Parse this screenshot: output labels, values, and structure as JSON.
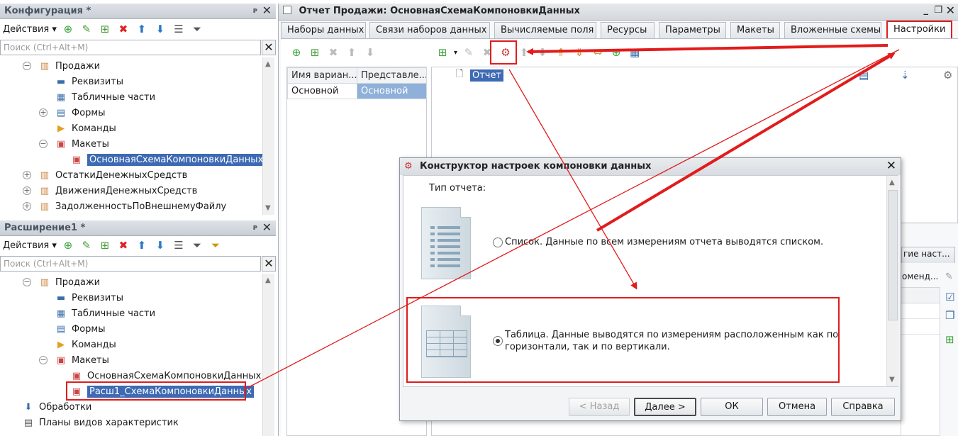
{
  "config_panel": {
    "title": "Конфигурация *",
    "actions_label": "Действия",
    "search_placeholder": "Поиск (Ctrl+Alt+M)",
    "tree": [
      {
        "label": "Продажи"
      },
      {
        "label": "Реквизиты"
      },
      {
        "label": "Табличные части"
      },
      {
        "label": "Формы"
      },
      {
        "label": "Команды"
      },
      {
        "label": "Макеты"
      },
      {
        "label": "ОсновнаяСхемаКомпоновкиДанных"
      },
      {
        "label": "ОстаткиДенежныхСредств"
      },
      {
        "label": "ДвиженияДенежныхСредств"
      },
      {
        "label": "ЗадолженностьПоВнешнемуФайлу"
      }
    ]
  },
  "extension_panel": {
    "title": "Расширение1 *",
    "actions_label": "Действия",
    "search_placeholder": "Поиск (Ctrl+Alt+M)",
    "tree": [
      {
        "label": "Продажи"
      },
      {
        "label": "Реквизиты"
      },
      {
        "label": "Табличные части"
      },
      {
        "label": "Формы"
      },
      {
        "label": "Команды"
      },
      {
        "label": "Макеты"
      },
      {
        "label": "ОсновнаяСхемаКомпоновкиДанных"
      },
      {
        "label": "Расш1_СхемаКомпоновкиДанных"
      },
      {
        "label": "Обработки"
      },
      {
        "label": "Планы видов характеристик"
      }
    ]
  },
  "report_window": {
    "title": "Отчет Продажи: ОсновнаяСхемаКомпоновкиДанных",
    "tabs": [
      "Наборы данных",
      "Связи наборов данных",
      "Вычисляемые поля",
      "Ресурсы",
      "Параметры",
      "Макеты",
      "Вложенные схемы",
      "Настройки"
    ],
    "active_tab": "Настройки",
    "variants_table": {
      "headers": [
        "Имя вариан...",
        "Представле..."
      ],
      "rows": [
        [
          "Основной",
          "Основной"
        ]
      ]
    },
    "structure_root": "Отчет",
    "partial_tab_label": "гие наст...",
    "partial_label": "оменд..."
  },
  "dialog": {
    "title": "Конструктор настроек компоновки данных",
    "report_type_label": "Тип отчета:",
    "option_list": "Список. Данные по всем измерениям отчета выводятся списком.",
    "option_table_line1": "Таблица. Данные выводятся по измерениям расположенным как по",
    "option_table_line2": "горизонтали, так и по вертикали.",
    "selected_option": "table",
    "buttons": {
      "back": "< Назад",
      "next": "Далее >",
      "ok": "ОК",
      "cancel": "Отмена",
      "help": "Справка"
    }
  },
  "colors": {
    "highlight_red": "#e21b1b",
    "selection_blue": "#3d6ab3",
    "panel_title_bg": "#d3d8de"
  }
}
